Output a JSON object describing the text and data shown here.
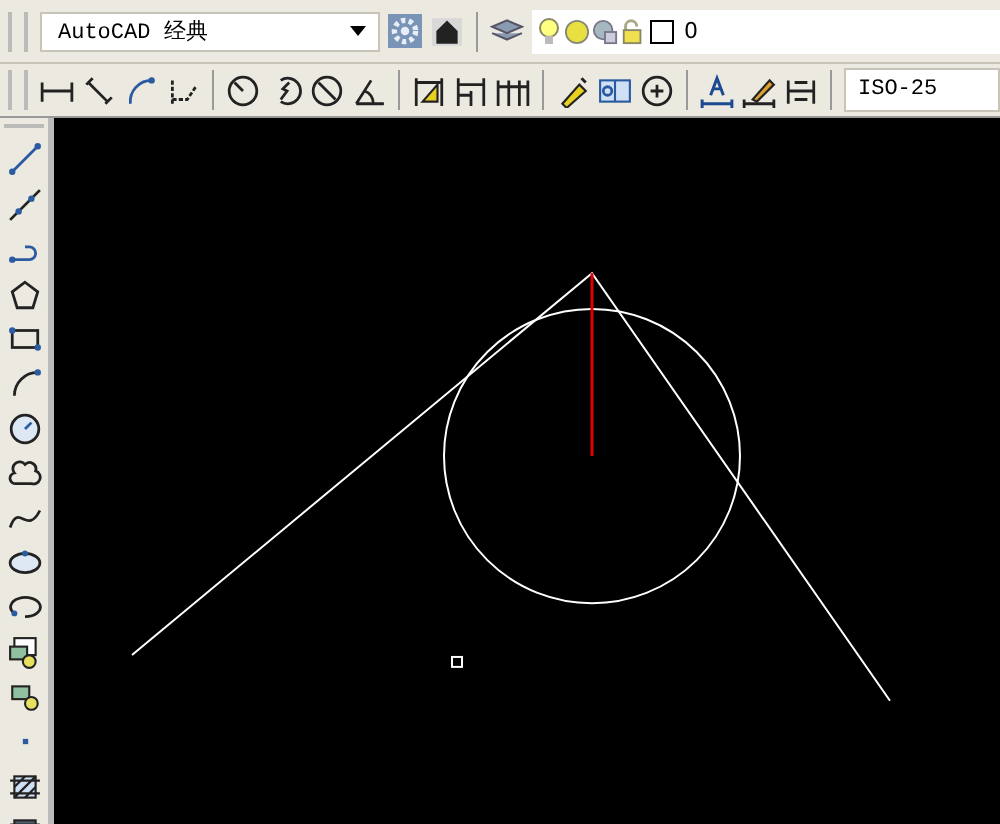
{
  "workspace": {
    "value": "AutoCAD 经典"
  },
  "layer": {
    "name": "0"
  },
  "dimension_style": {
    "value": "ISO-25"
  }
}
